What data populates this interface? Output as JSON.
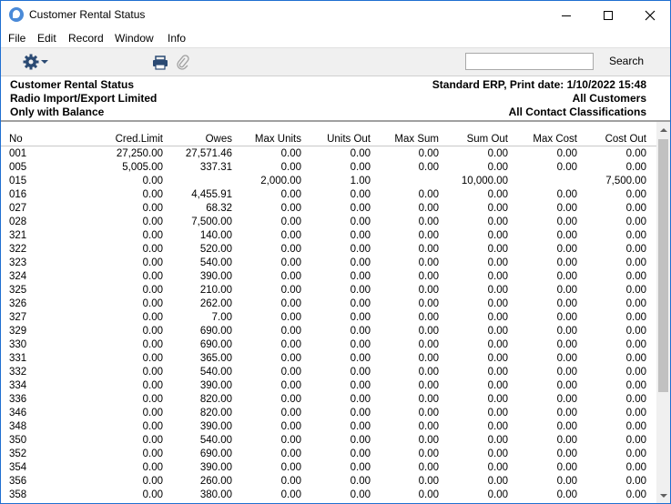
{
  "window": {
    "title": "Customer Rental Status",
    "icon": "hansa-app-icon",
    "controls": [
      "minimize",
      "maximize",
      "close"
    ]
  },
  "menu": [
    "File",
    "Edit",
    "Record",
    "Window",
    "Info"
  ],
  "toolbar": {
    "icons": [
      "gear-icon",
      "print-icon",
      "paperclip-icon"
    ],
    "search_value": "",
    "search_label": "Search"
  },
  "report_header": {
    "left": [
      "Customer Rental Status",
      "Radio Import/Export Limited",
      "Only with Balance"
    ],
    "right": [
      "Standard ERP, Print date: 1/10/2022 15:48",
      "All Customers",
      "All Contact Classifications"
    ]
  },
  "table": {
    "columns": [
      "No",
      "Cred.Limit",
      "Owes",
      "Max Units",
      "Units Out",
      "Max Sum",
      "Sum Out",
      "Max Cost",
      "Cost Out"
    ],
    "rows": [
      [
        "001",
        "27,250.00",
        "27,571.46",
        "0.00",
        "0.00",
        "0.00",
        "0.00",
        "0.00",
        "0.00"
      ],
      [
        "005",
        "5,005.00",
        "337.31",
        "0.00",
        "0.00",
        "0.00",
        "0.00",
        "0.00",
        "0.00"
      ],
      [
        "015",
        "0.00",
        "",
        "2,000.00",
        "1.00",
        "",
        "10,000.00",
        "",
        "7,500.00"
      ],
      [
        "016",
        "0.00",
        "4,455.91",
        "0.00",
        "0.00",
        "0.00",
        "0.00",
        "0.00",
        "0.00"
      ],
      [
        "027",
        "0.00",
        "68.32",
        "0.00",
        "0.00",
        "0.00",
        "0.00",
        "0.00",
        "0.00"
      ],
      [
        "028",
        "0.00",
        "7,500.00",
        "0.00",
        "0.00",
        "0.00",
        "0.00",
        "0.00",
        "0.00"
      ],
      [
        "321",
        "0.00",
        "140.00",
        "0.00",
        "0.00",
        "0.00",
        "0.00",
        "0.00",
        "0.00"
      ],
      [
        "322",
        "0.00",
        "520.00",
        "0.00",
        "0.00",
        "0.00",
        "0.00",
        "0.00",
        "0.00"
      ],
      [
        "323",
        "0.00",
        "540.00",
        "0.00",
        "0.00",
        "0.00",
        "0.00",
        "0.00",
        "0.00"
      ],
      [
        "324",
        "0.00",
        "390.00",
        "0.00",
        "0.00",
        "0.00",
        "0.00",
        "0.00",
        "0.00"
      ],
      [
        "325",
        "0.00",
        "210.00",
        "0.00",
        "0.00",
        "0.00",
        "0.00",
        "0.00",
        "0.00"
      ],
      [
        "326",
        "0.00",
        "262.00",
        "0.00",
        "0.00",
        "0.00",
        "0.00",
        "0.00",
        "0.00"
      ],
      [
        "327",
        "0.00",
        "7.00",
        "0.00",
        "0.00",
        "0.00",
        "0.00",
        "0.00",
        "0.00"
      ],
      [
        "329",
        "0.00",
        "690.00",
        "0.00",
        "0.00",
        "0.00",
        "0.00",
        "0.00",
        "0.00"
      ],
      [
        "330",
        "0.00",
        "690.00",
        "0.00",
        "0.00",
        "0.00",
        "0.00",
        "0.00",
        "0.00"
      ],
      [
        "331",
        "0.00",
        "365.00",
        "0.00",
        "0.00",
        "0.00",
        "0.00",
        "0.00",
        "0.00"
      ],
      [
        "332",
        "0.00",
        "540.00",
        "0.00",
        "0.00",
        "0.00",
        "0.00",
        "0.00",
        "0.00"
      ],
      [
        "334",
        "0.00",
        "390.00",
        "0.00",
        "0.00",
        "0.00",
        "0.00",
        "0.00",
        "0.00"
      ],
      [
        "336",
        "0.00",
        "820.00",
        "0.00",
        "0.00",
        "0.00",
        "0.00",
        "0.00",
        "0.00"
      ],
      [
        "346",
        "0.00",
        "820.00",
        "0.00",
        "0.00",
        "0.00",
        "0.00",
        "0.00",
        "0.00"
      ],
      [
        "348",
        "0.00",
        "390.00",
        "0.00",
        "0.00",
        "0.00",
        "0.00",
        "0.00",
        "0.00"
      ],
      [
        "350",
        "0.00",
        "540.00",
        "0.00",
        "0.00",
        "0.00",
        "0.00",
        "0.00",
        "0.00"
      ],
      [
        "352",
        "0.00",
        "690.00",
        "0.00",
        "0.00",
        "0.00",
        "0.00",
        "0.00",
        "0.00"
      ],
      [
        "354",
        "0.00",
        "390.00",
        "0.00",
        "0.00",
        "0.00",
        "0.00",
        "0.00",
        "0.00"
      ],
      [
        "356",
        "0.00",
        "260.00",
        "0.00",
        "0.00",
        "0.00",
        "0.00",
        "0.00",
        "0.00"
      ],
      [
        "358",
        "0.00",
        "380.00",
        "0.00",
        "0.00",
        "0.00",
        "0.00",
        "0.00",
        "0.00"
      ]
    ]
  },
  "colors": {
    "window_border": "#1f6fd1",
    "toolbar_bg": "#f0f0f0",
    "scroll_thumb": "#c1c1c1"
  }
}
